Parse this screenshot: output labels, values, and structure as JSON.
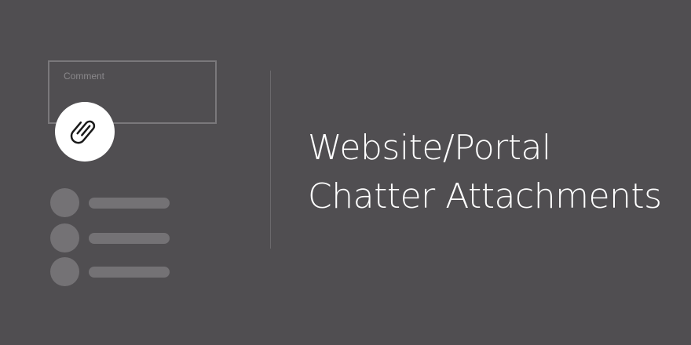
{
  "comment": {
    "placeholder": "Comment"
  },
  "attach_icon": "paperclip-icon",
  "list_items": [
    {
      "avatar": "avatar-placeholder",
      "line": "text-placeholder"
    },
    {
      "avatar": "avatar-placeholder",
      "line": "text-placeholder"
    },
    {
      "avatar": "avatar-placeholder",
      "line": "text-placeholder"
    }
  ],
  "headline": {
    "line1": "Website/Portal",
    "line2": "Chatter Attachments"
  },
  "colors": {
    "background": "#504e51",
    "placeholder_gray": "#747275",
    "text": "#ffffff"
  }
}
